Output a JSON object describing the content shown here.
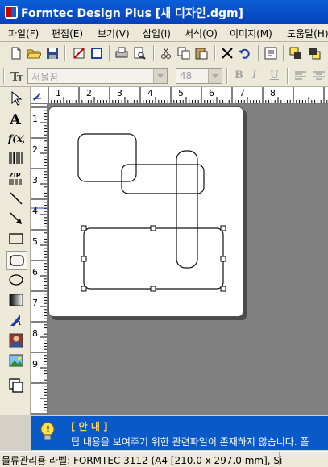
{
  "window": {
    "title": "Formtec Design Plus [새 디자인.dgm]"
  },
  "menu": [
    "파일(F)",
    "편집(E)",
    "보기(V)",
    "삽입(I)",
    "서식(O)",
    "이미지(M)",
    "도움말(H)"
  ],
  "format_toolbar": {
    "font_name": "서울꿈",
    "font_size": "48",
    "bold": "B",
    "italic": "I",
    "underline": "U"
  },
  "toolbar_icons": [
    "new-file-icon",
    "open-folder-icon",
    "save-icon",
    "page-setup-icon",
    "frame-icon",
    "print-icon",
    "print-preview-icon",
    "cut-icon",
    "copy-icon",
    "paste-icon",
    "delete-icon",
    "undo-icon",
    "properties-icon",
    "bring-front-icon",
    "send-back-icon"
  ],
  "tools": [
    "pointer-tool",
    "text-tool",
    "formula-tool",
    "barcode-tool",
    "zip-tool",
    "line-tool",
    "arrow-tool",
    "rectangle-tool",
    "rounded-rectangle-tool",
    "ellipse-tool",
    "gradient-tool",
    "sequence-tool",
    "photo-tool",
    "image-tool",
    "group-tool"
  ],
  "ruler": {
    "h_labels": [
      "1",
      "2",
      "3",
      "4",
      "5",
      "6",
      "7",
      "8"
    ],
    "v_labels": [
      "1",
      "2",
      "3",
      "4",
      "5",
      "6",
      "7",
      "8",
      "9"
    ]
  },
  "tip": {
    "title": "[ 안 내 ]",
    "message": "팁 내용을 보여주기 위한 관련파일이 존재하지 않습니다. 폴"
  },
  "status": {
    "text": "물류관리용 라벨: FORMTEC 3112 (A4 [210.0 x 297.0 mm], Si"
  },
  "colors": {
    "title_bar": "#0a5fd8",
    "tip_bar": "#0a59c8",
    "tip_title": "#ffd84a",
    "canvas": "#808080"
  }
}
